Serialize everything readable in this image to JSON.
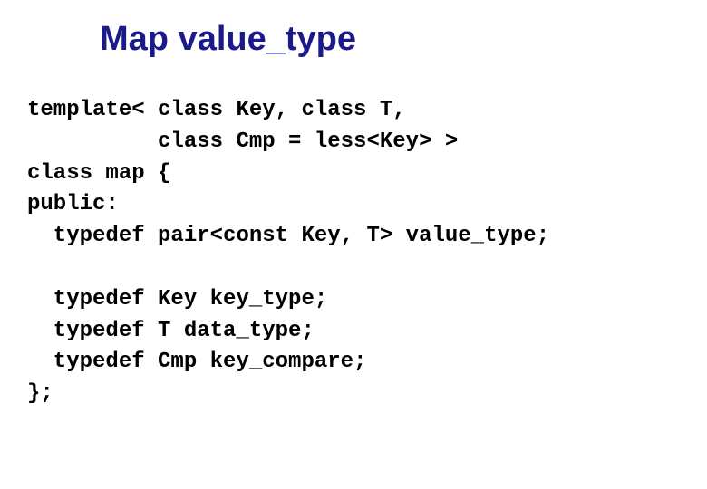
{
  "slide": {
    "title": "Map value_type",
    "code": "template< class Key, class T,\n          class Cmp = less<Key> >\nclass map {\npublic:\n  typedef pair<const Key, T> value_type;\n\n  typedef Key key_type;\n  typedef T data_type;\n  typedef Cmp key_compare;\n};"
  }
}
